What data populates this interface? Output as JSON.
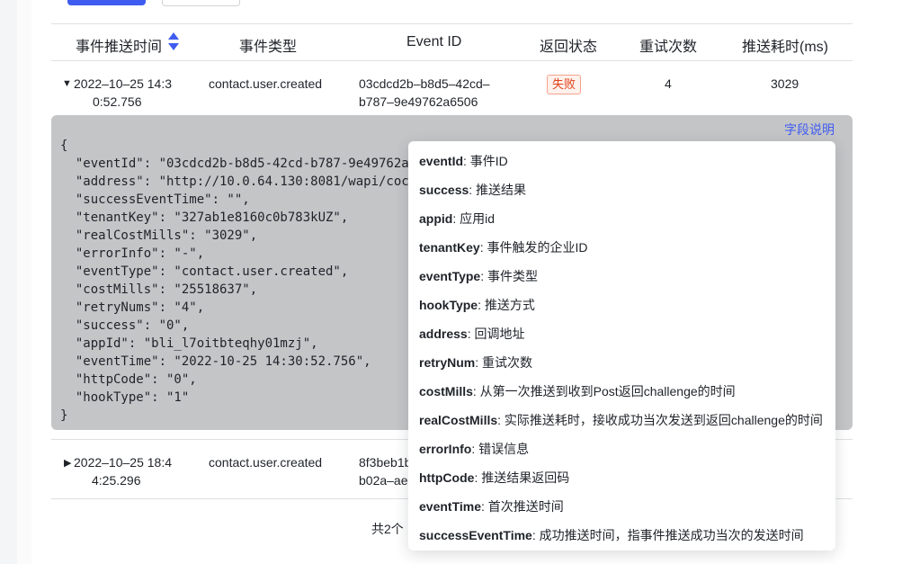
{
  "table": {
    "headers": [
      "事件推送时间",
      "事件类型",
      "Event ID",
      "返回状态",
      "重试次数",
      "推送耗时(ms)"
    ],
    "rows": [
      {
        "time_line1": "2022–10–25 14:3",
        "time_line2": "0:52.756",
        "event_type": "contact.user.created",
        "event_id_line1": "03cdcd2b–b8d5–42cd–",
        "event_id_line2": "b787–9e49762a6506",
        "status": "失败",
        "retries": "4",
        "cost": "3029"
      },
      {
        "time_line1": "2022–10–25 18:4",
        "time_line2": "4:25.296",
        "event_type": "contact.user.created",
        "event_id_line1": "8f3beb1b",
        "event_id_line2": "b02a–ae"
      }
    ]
  },
  "detail": {
    "field_desc_link": "字段说明",
    "json_lines": [
      "{",
      "  \"eventId\": \"03cdcd2b-b8d5-42cd-b787-9e49762a",
      "  \"address\": \"http://10.0.64.130:8081/wapi/coc",
      "  \"successEventTime\": \"\",",
      "  \"tenantKey\": \"327ab1e8160c0b783kUZ\",",
      "  \"realCostMills\": \"3029\",",
      "  \"errorInfo\": \"-\",",
      "  \"eventType\": \"contact.user.created\",",
      "  \"costMills\": \"25518637\",",
      "  \"retryNums\": \"4\",",
      "  \"success\": \"0\",",
      "  \"appId\": \"bli_l7oitbteqhy01mzj\",",
      "  \"eventTime\": \"2022-10-25 14:30:52.756\",",
      "  \"httpCode\": \"0\",",
      "  \"hookType\": \"1\"",
      "}"
    ]
  },
  "popover": {
    "items": [
      {
        "key": "eventId",
        "desc": ": 事件ID"
      },
      {
        "key": "success",
        "desc": ": 推送结果"
      },
      {
        "key": "appid",
        "desc": ": 应用id"
      },
      {
        "key": "tenantKey",
        "desc": ": 事件触发的企业ID"
      },
      {
        "key": "eventType",
        "desc": ": 事件类型"
      },
      {
        "key": "hookType",
        "desc": ": 推送方式"
      },
      {
        "key": "address",
        "desc": ": 回调地址"
      },
      {
        "key": "retryNum",
        "desc": ": 重试次数"
      },
      {
        "key": "costMills",
        "desc": ": 从第一次推送到收到Post返回challenge的时间"
      },
      {
        "key": "realCostMills",
        "desc": ": 实际推送耗时，接收成功当次发送到返回challenge的时间"
      },
      {
        "key": "errorInfo",
        "desc": ": 错误信息"
      },
      {
        "key": "httpCode",
        "desc": ": 推送结果返回码"
      },
      {
        "key": "eventTime",
        "desc": ": 首次推送时间"
      },
      {
        "key": "successEventTime",
        "desc": ": 成功推送时间，指事件推送成功当次的发送时间"
      }
    ]
  },
  "pagination": {
    "total": "共2个"
  },
  "colors": {
    "primary": "#3f5cf0",
    "danger": "#e0421a"
  }
}
